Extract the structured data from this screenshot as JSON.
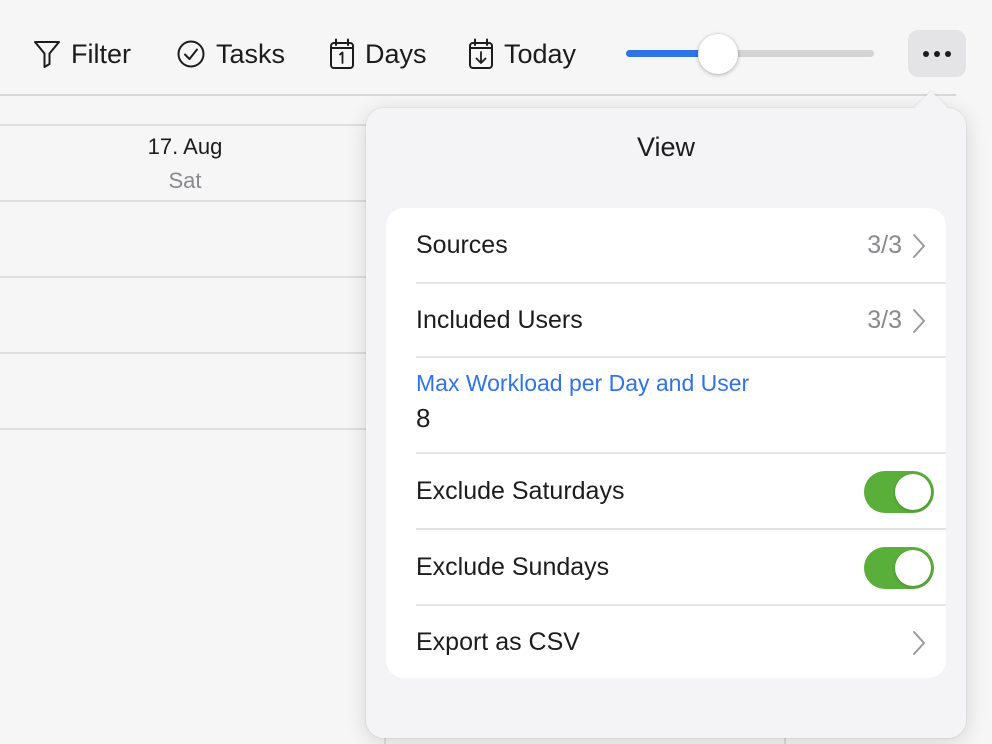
{
  "toolbar": {
    "filter_label": "Filter",
    "tasks_label": "Tasks",
    "days_label": "Days",
    "today_label": "Today",
    "zoom_slider_value": 0.37,
    "more_icon": "ellipsis-icon"
  },
  "calendar": {
    "day": {
      "date": "17. Aug",
      "weekday": "Sat"
    }
  },
  "view_popover": {
    "title": "View",
    "rows": {
      "sources": {
        "label": "Sources",
        "value": "3/3"
      },
      "included_users": {
        "label": "Included Users",
        "value": "3/3"
      },
      "max_workload": {
        "label": "Max Workload per Day and User",
        "value": "8"
      },
      "exclude_saturdays": {
        "label": "Exclude Saturdays",
        "enabled": true
      },
      "exclude_sundays": {
        "label": "Exclude Sundays",
        "enabled": true
      },
      "export_csv": {
        "label": "Export as CSV"
      }
    }
  },
  "colors": {
    "accent": "#2f74e6",
    "toggle_on": "#5aae3a",
    "secondary_text": "#8a8a8e"
  }
}
